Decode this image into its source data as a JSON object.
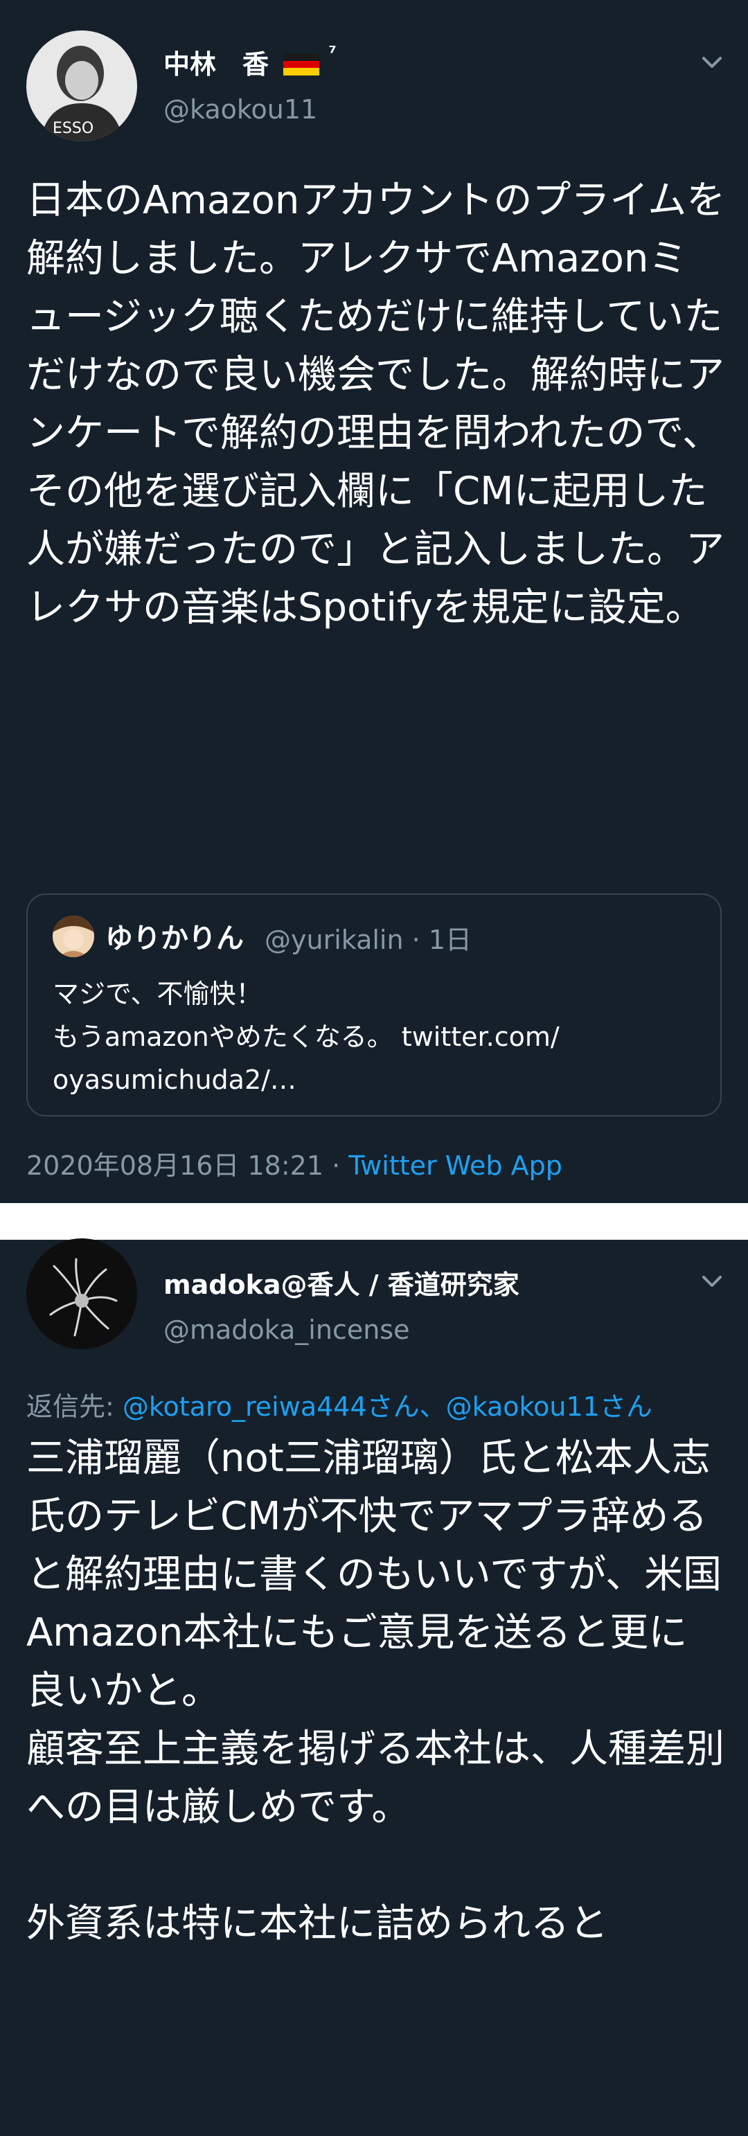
{
  "tweet1": {
    "display_name": "中林　香",
    "name_suffix": "⁷",
    "handle": "@kaokou11",
    "body": "日本のAmazonアカウントのプライムを解約しました。アレクサでAmazonミュージック聴くためだけに維持していただけなので良い機会でした。解約時にアンケートで解約の理由を問われたので、その他を選び記入欄に「CMに起用した人が嫌だったので」と記入しました。アレクサの音楽はSpotifyを規定に設定。",
    "quote": {
      "name": "ゆりかりん",
      "handle": "@yurikalin",
      "separator": " · ",
      "age": "1日",
      "text": "マジで、不愉快！\nもうamazonやめたくなる。 twitter.com/\noyasumichuda2/…"
    },
    "timestamp": "2020年08月16日 18:21",
    "footer_sep": " · ",
    "client": "Twitter Web App"
  },
  "tweet2": {
    "display_name": "madoka@香人 / 香道研究家",
    "handle": "@madoka_incense",
    "replying_label": "返信先: ",
    "replying_to": "@kotaro_reiwa444さん、@kaokou11さん",
    "body": "三浦瑠麗（not三浦瑠璃）氏と松本人志氏のテレビCMが不快でアマプラ辞めると解約理由に書くのもいいですが、米国Amazon本社にもご意見を送ると更に良いかと。\n顧客至上主義を掲げる本社は、人種差別への目は厳しめです。\n\n外資系は特に本社に詰められると"
  },
  "colors": {
    "background": "#15202b",
    "text": "#ffffff",
    "secondary": "#8899a6",
    "link": "#1da1f2",
    "border": "#38444d"
  },
  "icons": [
    "avatar",
    "germany-flag-icon",
    "chevron-down-icon",
    "quote-avatar"
  ]
}
